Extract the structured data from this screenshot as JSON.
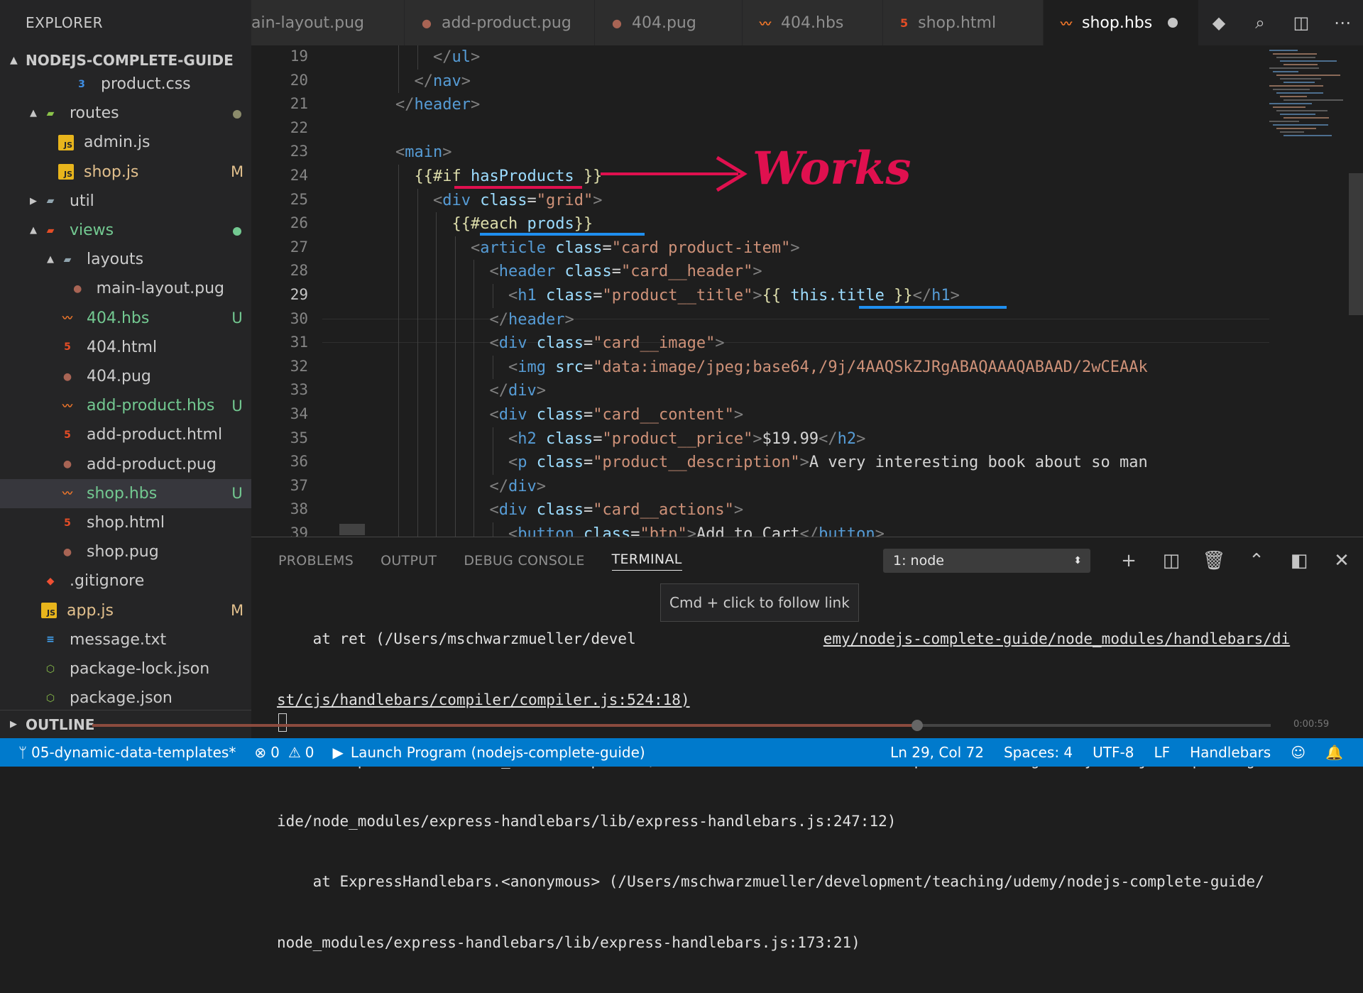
{
  "sidebar": {
    "title": "EXPLORER",
    "project": "NODEJS-COMPLETE-GUIDE",
    "outline": "OUTLINE",
    "items": [
      {
        "label": "product.css",
        "icon": "css-file-icon",
        "glyph": "3",
        "cls": "ico-css",
        "arrow": "",
        "badge": "",
        "color": "#cccccc"
      },
      {
        "label": "routes",
        "icon": "routes-folder-icon",
        "glyph": "▰",
        "cls": "ico-json",
        "arrow": "▲",
        "badge": "dot",
        "color": "#cccccc"
      },
      {
        "label": "admin.js",
        "icon": "js-file-icon",
        "glyph": "JS",
        "cls": "ico-js",
        "arrow": "",
        "badge": "",
        "color": "#cccccc"
      },
      {
        "label": "shop.js",
        "icon": "js-file-icon",
        "glyph": "JS",
        "cls": "ico-js",
        "arrow": "",
        "badge": "M",
        "color": "#e2c08d"
      },
      {
        "label": "util",
        "icon": "folder-icon",
        "glyph": "▰",
        "cls": "ico-folder",
        "arrow": "▶",
        "badge": "",
        "color": "#cccccc"
      },
      {
        "label": "views",
        "icon": "views-folder-icon",
        "glyph": "▰",
        "cls": "ico-html",
        "arrow": "▲",
        "badge": "dot",
        "color": "#73c991"
      },
      {
        "label": "layouts",
        "icon": "folder-open-icon",
        "glyph": "▰",
        "cls": "ico-folder",
        "arrow": "▲",
        "badge": "",
        "color": "#cccccc"
      },
      {
        "label": "main-layout.pug",
        "icon": "pug-file-icon",
        "glyph": "●",
        "cls": "ico-pug",
        "arrow": "",
        "badge": "",
        "color": "#cccccc"
      },
      {
        "label": "404.hbs",
        "icon": "handlebars-file-icon",
        "glyph": "〰",
        "cls": "ico-hbs",
        "arrow": "",
        "badge": "U",
        "color": "#73c991"
      },
      {
        "label": "404.html",
        "icon": "html-file-icon",
        "glyph": "5",
        "cls": "ico-html",
        "arrow": "",
        "badge": "",
        "color": "#cccccc"
      },
      {
        "label": "404.pug",
        "icon": "pug-file-icon",
        "glyph": "●",
        "cls": "ico-pug",
        "arrow": "",
        "badge": "",
        "color": "#cccccc"
      },
      {
        "label": "add-product.hbs",
        "icon": "handlebars-file-icon",
        "glyph": "〰",
        "cls": "ico-hbs",
        "arrow": "",
        "badge": "U",
        "color": "#73c991"
      },
      {
        "label": "add-product.html",
        "icon": "html-file-icon",
        "glyph": "5",
        "cls": "ico-html",
        "arrow": "",
        "badge": "",
        "color": "#cccccc"
      },
      {
        "label": "add-product.pug",
        "icon": "pug-file-icon",
        "glyph": "●",
        "cls": "ico-pug",
        "arrow": "",
        "badge": "",
        "color": "#cccccc"
      },
      {
        "label": "shop.hbs",
        "icon": "handlebars-file-icon",
        "glyph": "〰",
        "cls": "ico-hbs",
        "arrow": "",
        "badge": "U",
        "color": "#73c991",
        "active": true
      },
      {
        "label": "shop.html",
        "icon": "html-file-icon",
        "glyph": "5",
        "cls": "ico-html",
        "arrow": "",
        "badge": "",
        "color": "#cccccc"
      },
      {
        "label": "shop.pug",
        "icon": "pug-file-icon",
        "glyph": "●",
        "cls": "ico-pug",
        "arrow": "",
        "badge": "",
        "color": "#cccccc"
      },
      {
        "label": ".gitignore",
        "icon": "git-icon",
        "glyph": "◆",
        "cls": "ico-git",
        "arrow": "",
        "badge": "",
        "color": "#cccccc"
      },
      {
        "label": "app.js",
        "icon": "js-file-icon",
        "glyph": "JS",
        "cls": "ico-js",
        "arrow": "",
        "badge": "M",
        "color": "#e2c08d"
      },
      {
        "label": "message.txt",
        "icon": "text-file-icon",
        "glyph": "≡",
        "cls": "ico-txt",
        "arrow": "",
        "badge": "",
        "color": "#cccccc"
      },
      {
        "label": "package-lock.json",
        "icon": "json-file-icon",
        "glyph": "⬡",
        "cls": "ico-json",
        "arrow": "",
        "badge": "",
        "color": "#cccccc"
      },
      {
        "label": "package.json",
        "icon": "json-file-icon",
        "glyph": "⬡",
        "cls": "ico-json",
        "arrow": "",
        "badge": "",
        "color": "#cccccc"
      }
    ]
  },
  "tabs": [
    {
      "label": "ain-layout.pug",
      "icon": "",
      "glyph": "",
      "cls": ""
    },
    {
      "label": "add-product.pug",
      "icon": "pug-file-icon",
      "glyph": "●",
      "cls": "ico-pug"
    },
    {
      "label": "404.pug",
      "icon": "pug-file-icon",
      "glyph": "●",
      "cls": "ico-pug"
    },
    {
      "label": "404.hbs",
      "icon": "handlebars-file-icon",
      "glyph": "〰",
      "cls": "ico-hbs"
    },
    {
      "label": "shop.html",
      "icon": "html-file-icon",
      "glyph": "5",
      "cls": "ico-html"
    },
    {
      "label": "shop.hbs",
      "icon": "handlebars-file-icon",
      "glyph": "〰",
      "cls": "ico-hbs",
      "active": true,
      "modified": true
    }
  ],
  "editor": {
    "current_line": 29,
    "lines": [
      {
        "n": 19,
        "indent": 8,
        "tokens": [
          [
            "</",
            "punc"
          ],
          [
            "ul",
            "tag"
          ],
          [
            ">",
            "punc"
          ]
        ]
      },
      {
        "n": 20,
        "indent": 6,
        "tokens": [
          [
            "</",
            "punc"
          ],
          [
            "nav",
            "tag"
          ],
          [
            ">",
            "punc"
          ]
        ]
      },
      {
        "n": 21,
        "indent": 4,
        "tokens": [
          [
            "</",
            "punc"
          ],
          [
            "header",
            "tag"
          ],
          [
            ">",
            "punc"
          ]
        ]
      },
      {
        "n": 22,
        "indent": 0,
        "tokens": []
      },
      {
        "n": 23,
        "indent": 4,
        "tokens": [
          [
            "<",
            "punc"
          ],
          [
            "main",
            "tag"
          ],
          [
            ">",
            "punc"
          ]
        ]
      },
      {
        "n": 24,
        "indent": 6,
        "tokens": [
          [
            "{{#if ",
            "hbs"
          ],
          [
            "hasProducts",
            "attr"
          ],
          [
            " }}",
            "hbs"
          ]
        ]
      },
      {
        "n": 25,
        "indent": 8,
        "tokens": [
          [
            "<",
            "punc"
          ],
          [
            "div",
            "tag"
          ],
          [
            " class",
            "attr"
          ],
          [
            "=",
            "txt"
          ],
          [
            "\"grid\"",
            "str"
          ],
          [
            ">",
            "punc"
          ]
        ]
      },
      {
        "n": 26,
        "indent": 10,
        "tokens": [
          [
            "{{#each ",
            "hbs"
          ],
          [
            "prods",
            "attr"
          ],
          [
            "}}",
            "hbs"
          ]
        ]
      },
      {
        "n": 27,
        "indent": 12,
        "tokens": [
          [
            "<",
            "punc"
          ],
          [
            "article",
            "tag"
          ],
          [
            " class",
            "attr"
          ],
          [
            "=",
            "txt"
          ],
          [
            "\"card product-item\"",
            "str"
          ],
          [
            ">",
            "punc"
          ]
        ]
      },
      {
        "n": 28,
        "indent": 14,
        "tokens": [
          [
            "<",
            "punc"
          ],
          [
            "header",
            "tag"
          ],
          [
            " class",
            "attr"
          ],
          [
            "=",
            "txt"
          ],
          [
            "\"card__header\"",
            "str"
          ],
          [
            ">",
            "punc"
          ]
        ]
      },
      {
        "n": 29,
        "indent": 16,
        "tokens": [
          [
            "<",
            "punc"
          ],
          [
            "h1",
            "tag"
          ],
          [
            " class",
            "attr"
          ],
          [
            "=",
            "txt"
          ],
          [
            "\"product__title\"",
            "str"
          ],
          [
            ">",
            "punc"
          ],
          [
            "{{ ",
            "hbs"
          ],
          [
            "this.title",
            "attr"
          ],
          [
            " }}",
            "hbs"
          ],
          [
            "</",
            "punc"
          ],
          [
            "h1",
            "tag"
          ],
          [
            ">",
            "punc"
          ]
        ]
      },
      {
        "n": 30,
        "indent": 14,
        "tokens": [
          [
            "</",
            "punc"
          ],
          [
            "header",
            "tag"
          ],
          [
            ">",
            "punc"
          ]
        ]
      },
      {
        "n": 31,
        "indent": 14,
        "tokens": [
          [
            "<",
            "punc"
          ],
          [
            "div",
            "tag"
          ],
          [
            " class",
            "attr"
          ],
          [
            "=",
            "txt"
          ],
          [
            "\"card__image\"",
            "str"
          ],
          [
            ">",
            "punc"
          ]
        ]
      },
      {
        "n": 32,
        "indent": 16,
        "tokens": [
          [
            "<",
            "punc"
          ],
          [
            "img",
            "tag"
          ],
          [
            " src",
            "attr"
          ],
          [
            "=",
            "txt"
          ],
          [
            "\"data:image/jpeg;base64,/9j/4AAQSkZJRgABAQAAAQABAAD/2wCEAAk",
            "str"
          ]
        ]
      },
      {
        "n": 33,
        "indent": 14,
        "tokens": [
          [
            "</",
            "punc"
          ],
          [
            "div",
            "tag"
          ],
          [
            ">",
            "punc"
          ]
        ]
      },
      {
        "n": 34,
        "indent": 14,
        "tokens": [
          [
            "<",
            "punc"
          ],
          [
            "div",
            "tag"
          ],
          [
            " class",
            "attr"
          ],
          [
            "=",
            "txt"
          ],
          [
            "\"card__content\"",
            "str"
          ],
          [
            ">",
            "punc"
          ]
        ]
      },
      {
        "n": 35,
        "indent": 16,
        "tokens": [
          [
            "<",
            "punc"
          ],
          [
            "h2",
            "tag"
          ],
          [
            " class",
            "attr"
          ],
          [
            "=",
            "txt"
          ],
          [
            "\"product__price\"",
            "str"
          ],
          [
            ">",
            "punc"
          ],
          [
            "$19.99",
            "txt"
          ],
          [
            "</",
            "punc"
          ],
          [
            "h2",
            "tag"
          ],
          [
            ">",
            "punc"
          ]
        ]
      },
      {
        "n": 36,
        "indent": 16,
        "tokens": [
          [
            "<",
            "punc"
          ],
          [
            "p",
            "tag"
          ],
          [
            " class",
            "attr"
          ],
          [
            "=",
            "txt"
          ],
          [
            "\"product__description\"",
            "str"
          ],
          [
            ">",
            "punc"
          ],
          [
            "A very interesting book about so man",
            "txt"
          ]
        ]
      },
      {
        "n": 37,
        "indent": 14,
        "tokens": [
          [
            "</",
            "punc"
          ],
          [
            "div",
            "tag"
          ],
          [
            ">",
            "punc"
          ]
        ]
      },
      {
        "n": 38,
        "indent": 14,
        "tokens": [
          [
            "<",
            "punc"
          ],
          [
            "div",
            "tag"
          ],
          [
            " class",
            "attr"
          ],
          [
            "=",
            "txt"
          ],
          [
            "\"card__actions\"",
            "str"
          ],
          [
            ">",
            "punc"
          ]
        ]
      },
      {
        "n": 39,
        "indent": 16,
        "tokens": [
          [
            "<",
            "punc"
          ],
          [
            "button",
            "tag"
          ],
          [
            " class",
            "attr"
          ],
          [
            "=",
            "txt"
          ],
          [
            "\"btn\"",
            "str"
          ],
          [
            ">",
            "punc"
          ],
          [
            "Add to Cart",
            "txt"
          ],
          [
            "</",
            "punc"
          ],
          [
            "button",
            "tag"
          ],
          [
            ">",
            "punc"
          ]
        ]
      }
    ]
  },
  "annotation": {
    "text": "Works",
    "color": "#e0104f"
  },
  "panel": {
    "tabs": [
      "PROBLEMS",
      "OUTPUT",
      "DEBUG CONSOLE",
      "TERMINAL"
    ],
    "active_tab": "TERMINAL",
    "terminal_select": "1: node",
    "tooltip": "Cmd + click to follow link",
    "terminal_lines": [
      "    at ret (/Users/mschwarzmueller/devel",
      "st/cjs/handlebars/compiler/compiler.js:524:18)",
      "    at ExpressHandlebars._renderTemplate (/Users/mschwarzmueller/development/teaching/udemy/nodejs-complete-gu",
      "ide/node_modules/express-handlebars/lib/express-handlebars.js:247:12)",
      "    at ExpressHandlebars.<anonymous> (/Users/mschwarzmueller/development/teaching/udemy/nodejs-complete-guide/",
      "node_modules/express-handlebars/lib/express-handlebars.js:173:21)"
    ],
    "terminal_line0_tail": "emy/nodejs-complete-guide/node_modules/handlebars/di"
  },
  "video": {
    "progress": 0.7,
    "time": "0:00:59"
  },
  "status": {
    "branch": "05-dynamic-data-templates*",
    "errors": "0",
    "warnings": "0",
    "launch": "Launch Program (nodejs-complete-guide)",
    "position": "Ln 29, Col 72",
    "spaces": "Spaces: 4",
    "encoding": "UTF-8",
    "eol": "LF",
    "language": "Handlebars",
    "accent": "#007acc"
  }
}
